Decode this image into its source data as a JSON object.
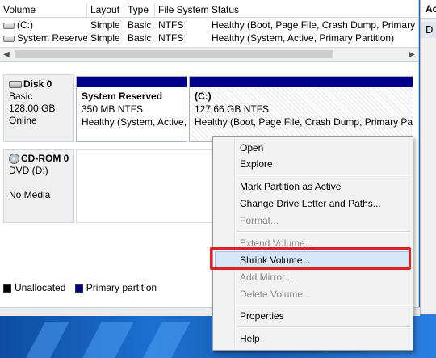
{
  "volume_list": {
    "columns": [
      "Volume",
      "Layout",
      "Type",
      "File System",
      "Status"
    ],
    "rows": [
      {
        "volume": "(C:)",
        "layout": "Simple",
        "type": "Basic",
        "fs": "NTFS",
        "status": "Healthy (Boot, Page File, Crash Dump, Primary Par"
      },
      {
        "volume": "System Reserved",
        "layout": "Simple",
        "type": "Basic",
        "fs": "NTFS",
        "status": "Healthy (System, Active, Primary Partition)"
      }
    ]
  },
  "actions": {
    "header": "Ac",
    "item": "D"
  },
  "disks": [
    {
      "name": "Disk 0",
      "kind": "Basic",
      "size": "128.00 GB",
      "state": "Online",
      "partitions": [
        {
          "name": "System Reserved",
          "size": "350 MB NTFS",
          "status": "Healthy (System, Active,"
        },
        {
          "name": "(C:)",
          "size": "127.66 GB NTFS",
          "status": "Healthy (Boot, Page File, Crash Dump, Primary Partiti"
        }
      ]
    },
    {
      "name": "CD-ROM 0",
      "kind": "DVD (D:)",
      "state": "No Media"
    }
  ],
  "legend": [
    {
      "label": "Unallocated",
      "color": "#000000"
    },
    {
      "label": "Primary partition",
      "color": "#00008b"
    }
  ],
  "context_menu": {
    "items": [
      {
        "label": "Open",
        "enabled": true
      },
      {
        "label": "Explore",
        "enabled": true
      },
      {
        "label": "Mark Partition as Active",
        "enabled": true
      },
      {
        "label": "Change Drive Letter and Paths...",
        "enabled": true
      },
      {
        "label": "Format...",
        "enabled": false
      },
      {
        "label": "Extend Volume...",
        "enabled": false
      },
      {
        "label": "Shrink Volume...",
        "enabled": true,
        "highlighted": true
      },
      {
        "label": "Add Mirror...",
        "enabled": false
      },
      {
        "label": "Delete Volume...",
        "enabled": false
      },
      {
        "label": "Properties",
        "enabled": true
      },
      {
        "label": "Help",
        "enabled": true
      }
    ]
  },
  "highlight_color": "#e01e25"
}
